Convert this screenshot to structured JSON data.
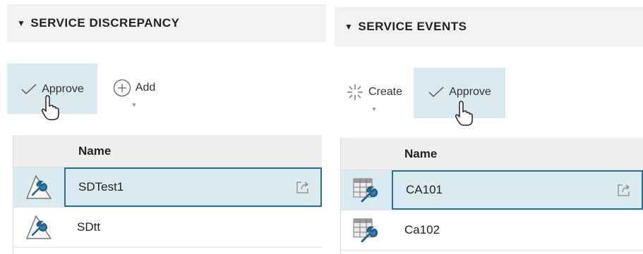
{
  "left_panel": {
    "title": "SERVICE DISCREPANCY",
    "toolbar": {
      "approve_label": "Approve",
      "add_label": "Add"
    },
    "grid": {
      "column_name": "Name",
      "rows": [
        {
          "name": "SDTest1",
          "selected": true
        },
        {
          "name": "SDtt",
          "selected": false
        }
      ]
    }
  },
  "right_panel": {
    "title": "SERVICE EVENTS",
    "toolbar": {
      "create_label": "Create",
      "approve_label": "Approve"
    },
    "grid": {
      "column_name": "Name",
      "rows": [
        {
          "name": "CA101",
          "selected": true
        },
        {
          "name": "Ca102",
          "selected": false
        }
      ]
    }
  },
  "colors": {
    "highlight": "#d8e9f0",
    "selected_border": "#2c6e8f",
    "icon_blue": "#2f7fb0"
  }
}
